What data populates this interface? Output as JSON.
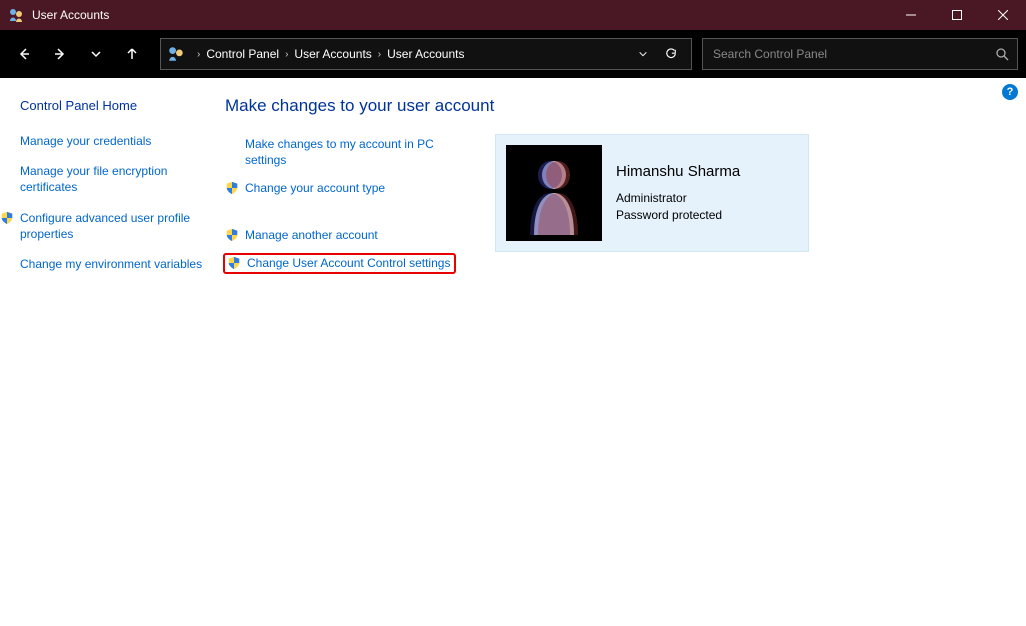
{
  "window": {
    "title": "User Accounts"
  },
  "toolbar": {
    "breadcrumbs": [
      "Control Panel",
      "User Accounts",
      "User Accounts"
    ],
    "search_placeholder": "Search Control Panel"
  },
  "sidebar": {
    "home": "Control Panel Home",
    "links": [
      {
        "label": "Manage your credentials",
        "shield": false
      },
      {
        "label": "Manage your file encryption certificates",
        "shield": false
      },
      {
        "label": "Configure advanced user profile properties",
        "shield": true
      },
      {
        "label": "Change my environment variables",
        "shield": false
      }
    ]
  },
  "main": {
    "heading": "Make changes to your user account",
    "actions_top": [
      {
        "label": "Make changes to my account in PC settings",
        "shield": false
      },
      {
        "label": "Change your account type",
        "shield": true
      }
    ],
    "actions_bottom": [
      {
        "label": "Manage another account",
        "shield": true
      },
      {
        "label": "Change User Account Control settings",
        "shield": true,
        "highlighted": true
      }
    ]
  },
  "user": {
    "name": "Himanshu Sharma",
    "role": "Administrator",
    "password_status": "Password protected"
  },
  "help_label": "?"
}
